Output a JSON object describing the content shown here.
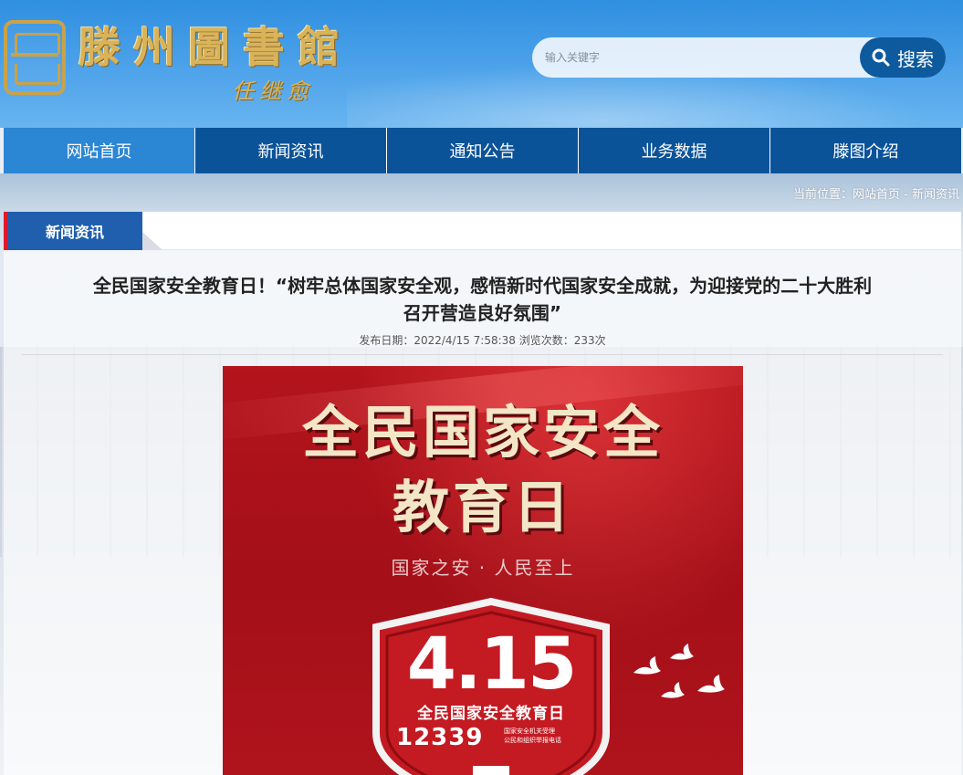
{
  "header": {
    "logo_title": "滕州圖書館",
    "logo_signature": "任继愈"
  },
  "search": {
    "placeholder": "输入关键字",
    "button_label": "搜索"
  },
  "nav": {
    "items": [
      {
        "label": "网站首页",
        "active": true
      },
      {
        "label": "新闻资讯",
        "active": false
      },
      {
        "label": "通知公告",
        "active": false
      },
      {
        "label": "业务数据",
        "active": false
      },
      {
        "label": "滕图介绍",
        "active": false
      }
    ]
  },
  "breadcrumb": {
    "prefix": "当前位置：",
    "home": "网站首页",
    "separator": " - ",
    "current": "新闻资讯"
  },
  "section": {
    "tab_label": "新闻资讯"
  },
  "article": {
    "title_line1": "全民国家安全教育日！“树牢总体国家安全观，感悟新时代国家安全成就，为迎接党的二十大胜利",
    "title_line2": "召开营造良好氛围”",
    "meta": "发布日期：2022/4/15 7:58:38 浏览次数：233次"
  },
  "poster": {
    "title_line1": "全民国家安全",
    "title_line2": "教育日",
    "slogan": "国家之安 · 人民至上",
    "date": "4.15",
    "caption": "全民国家安全教育日",
    "hotline": "12339",
    "hotline_note_line1": "国家安全机关受理",
    "hotline_note_line2": "公民和组织举报电话"
  },
  "colors": {
    "header_blue": "#2f8fe0",
    "nav_blue": "#0b5399",
    "nav_active": "#2b86d4",
    "search_button": "#0e5a9e",
    "tab_blue": "#1f5fae",
    "tab_accent_red": "#e0182a",
    "poster_red": "#b4141c",
    "logo_gold": "#d9b35a"
  }
}
